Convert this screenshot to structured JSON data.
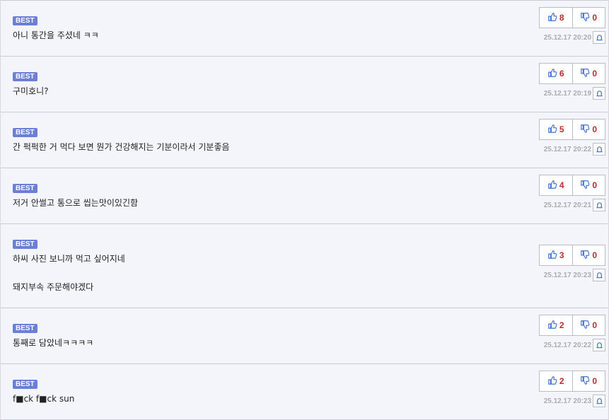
{
  "comments": [
    {
      "badge": "BEST",
      "text": "아니 통간을 주셨네 ㅋㅋ",
      "up": "8",
      "down": "0",
      "date": "25.12.17 20:20"
    },
    {
      "badge": "BEST",
      "text": "구미호니?",
      "up": "6",
      "down": "0",
      "date": "25.12.17 20:19"
    },
    {
      "badge": "BEST",
      "text": "간 퍽퍽한 거 먹다 보면 뭔가 건강해지는 기분이라서 기분좋음",
      "up": "5",
      "down": "0",
      "date": "25.12.17 20:22"
    },
    {
      "badge": "BEST",
      "text": "저거 안썰고 통으로 씹는맛이있긴함",
      "up": "4",
      "down": "0",
      "date": "25.12.17 20:21"
    },
    {
      "badge": "BEST",
      "text": "하씨 사진 보니까 먹고 싶어지네\n\n돼지부속 주문해야겠다",
      "up": "3",
      "down": "0",
      "date": "25.12.17 20:23"
    },
    {
      "badge": "BEST",
      "text": "통째로 담았네ㅋㅋㅋㅋ",
      "up": "2",
      "down": "0",
      "date": "25.12.17 20:22"
    },
    {
      "badge": "BEST",
      "text": "f■ck f■ck sun",
      "up": "2",
      "down": "0",
      "date": "25.12.17 20:23"
    }
  ],
  "icons": {
    "upvote": "thumbs-up-icon",
    "downvote": "thumbs-down-icon",
    "report": "bell-icon"
  },
  "colors": {
    "badge": "#6b7fd7",
    "count": "#c0282a",
    "row_bg": "#f3f5fa",
    "date": "#a9acb3",
    "icon": "#3d6fd1"
  }
}
